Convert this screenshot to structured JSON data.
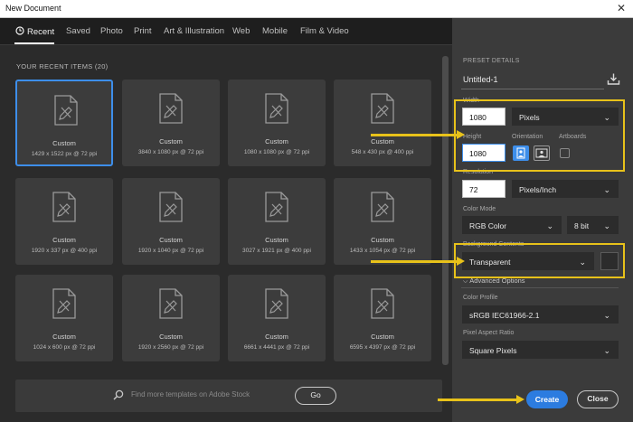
{
  "window": {
    "title": "New Document",
    "close_glyph": "✕"
  },
  "tabs": [
    {
      "label": "Recent",
      "icon": "clock-icon"
    },
    {
      "label": "Saved"
    },
    {
      "label": "Photo"
    },
    {
      "label": "Print"
    },
    {
      "label": "Art & Illustration"
    },
    {
      "label": "Web"
    },
    {
      "label": "Mobile"
    },
    {
      "label": "Film & Video"
    }
  ],
  "recent": {
    "title": "YOUR RECENT ITEMS  (20)",
    "items": [
      {
        "name": "Custom",
        "size": "1429 x 1522 px @ 72 ppi"
      },
      {
        "name": "Custom",
        "size": "3840 x 1080 px @ 72 ppi"
      },
      {
        "name": "Custom",
        "size": "1080 x 1080 px @ 72 ppi"
      },
      {
        "name": "Custom",
        "size": "548 x 430 px @ 400 ppi"
      },
      {
        "name": "Custom",
        "size": "1920 x 337 px @ 400 ppi"
      },
      {
        "name": "Custom",
        "size": "1920 x 1040 px @ 72 ppi"
      },
      {
        "name": "Custom",
        "size": "3027 x 1921 px @ 400 ppi"
      },
      {
        "name": "Custom",
        "size": "1433 x 1054 px @ 72 ppi"
      },
      {
        "name": "Custom",
        "size": "1024 x 600 px @ 72 ppi"
      },
      {
        "name": "Custom",
        "size": "1920 x 2560 px @ 72 ppi"
      },
      {
        "name": "Custom",
        "size": "6661 x 4441 px @ 72 ppi"
      },
      {
        "name": "Custom",
        "size": "6595 x 4397 px @ 72 ppi"
      }
    ]
  },
  "search": {
    "placeholder": "Find more templates on Adobe Stock",
    "go_label": "Go"
  },
  "preset": {
    "section_label": "PRESET DETAILS",
    "name": "Untitled-1",
    "width_label": "Width",
    "width_value": "1080",
    "width_unit": "Pixels",
    "height_label": "Height",
    "height_value": "1080",
    "orientation_label": "Orientation",
    "artboards_label": "Artboards",
    "resolution_label": "Resolution",
    "resolution_value": "72",
    "resolution_unit": "Pixels/Inch",
    "color_mode_label": "Color Mode",
    "color_mode_value": "RGB Color",
    "bit_depth": "8 bit",
    "background_label": "Background Contents",
    "background_value": "Transparent",
    "advanced_label": "Advanced Options",
    "color_profile_label": "Color Profile",
    "color_profile_value": "sRGB IEC61966-2.1",
    "pixel_aspect_label": "Pixel Aspect Ratio",
    "pixel_aspect_value": "Square Pixels"
  },
  "footer": {
    "create_label": "Create",
    "close_label": "Close"
  },
  "colors": {
    "accent": "#2c7ce0",
    "highlight": "#e8c21a",
    "panel": "#3b3b3b",
    "background": "#2b2b2b"
  }
}
